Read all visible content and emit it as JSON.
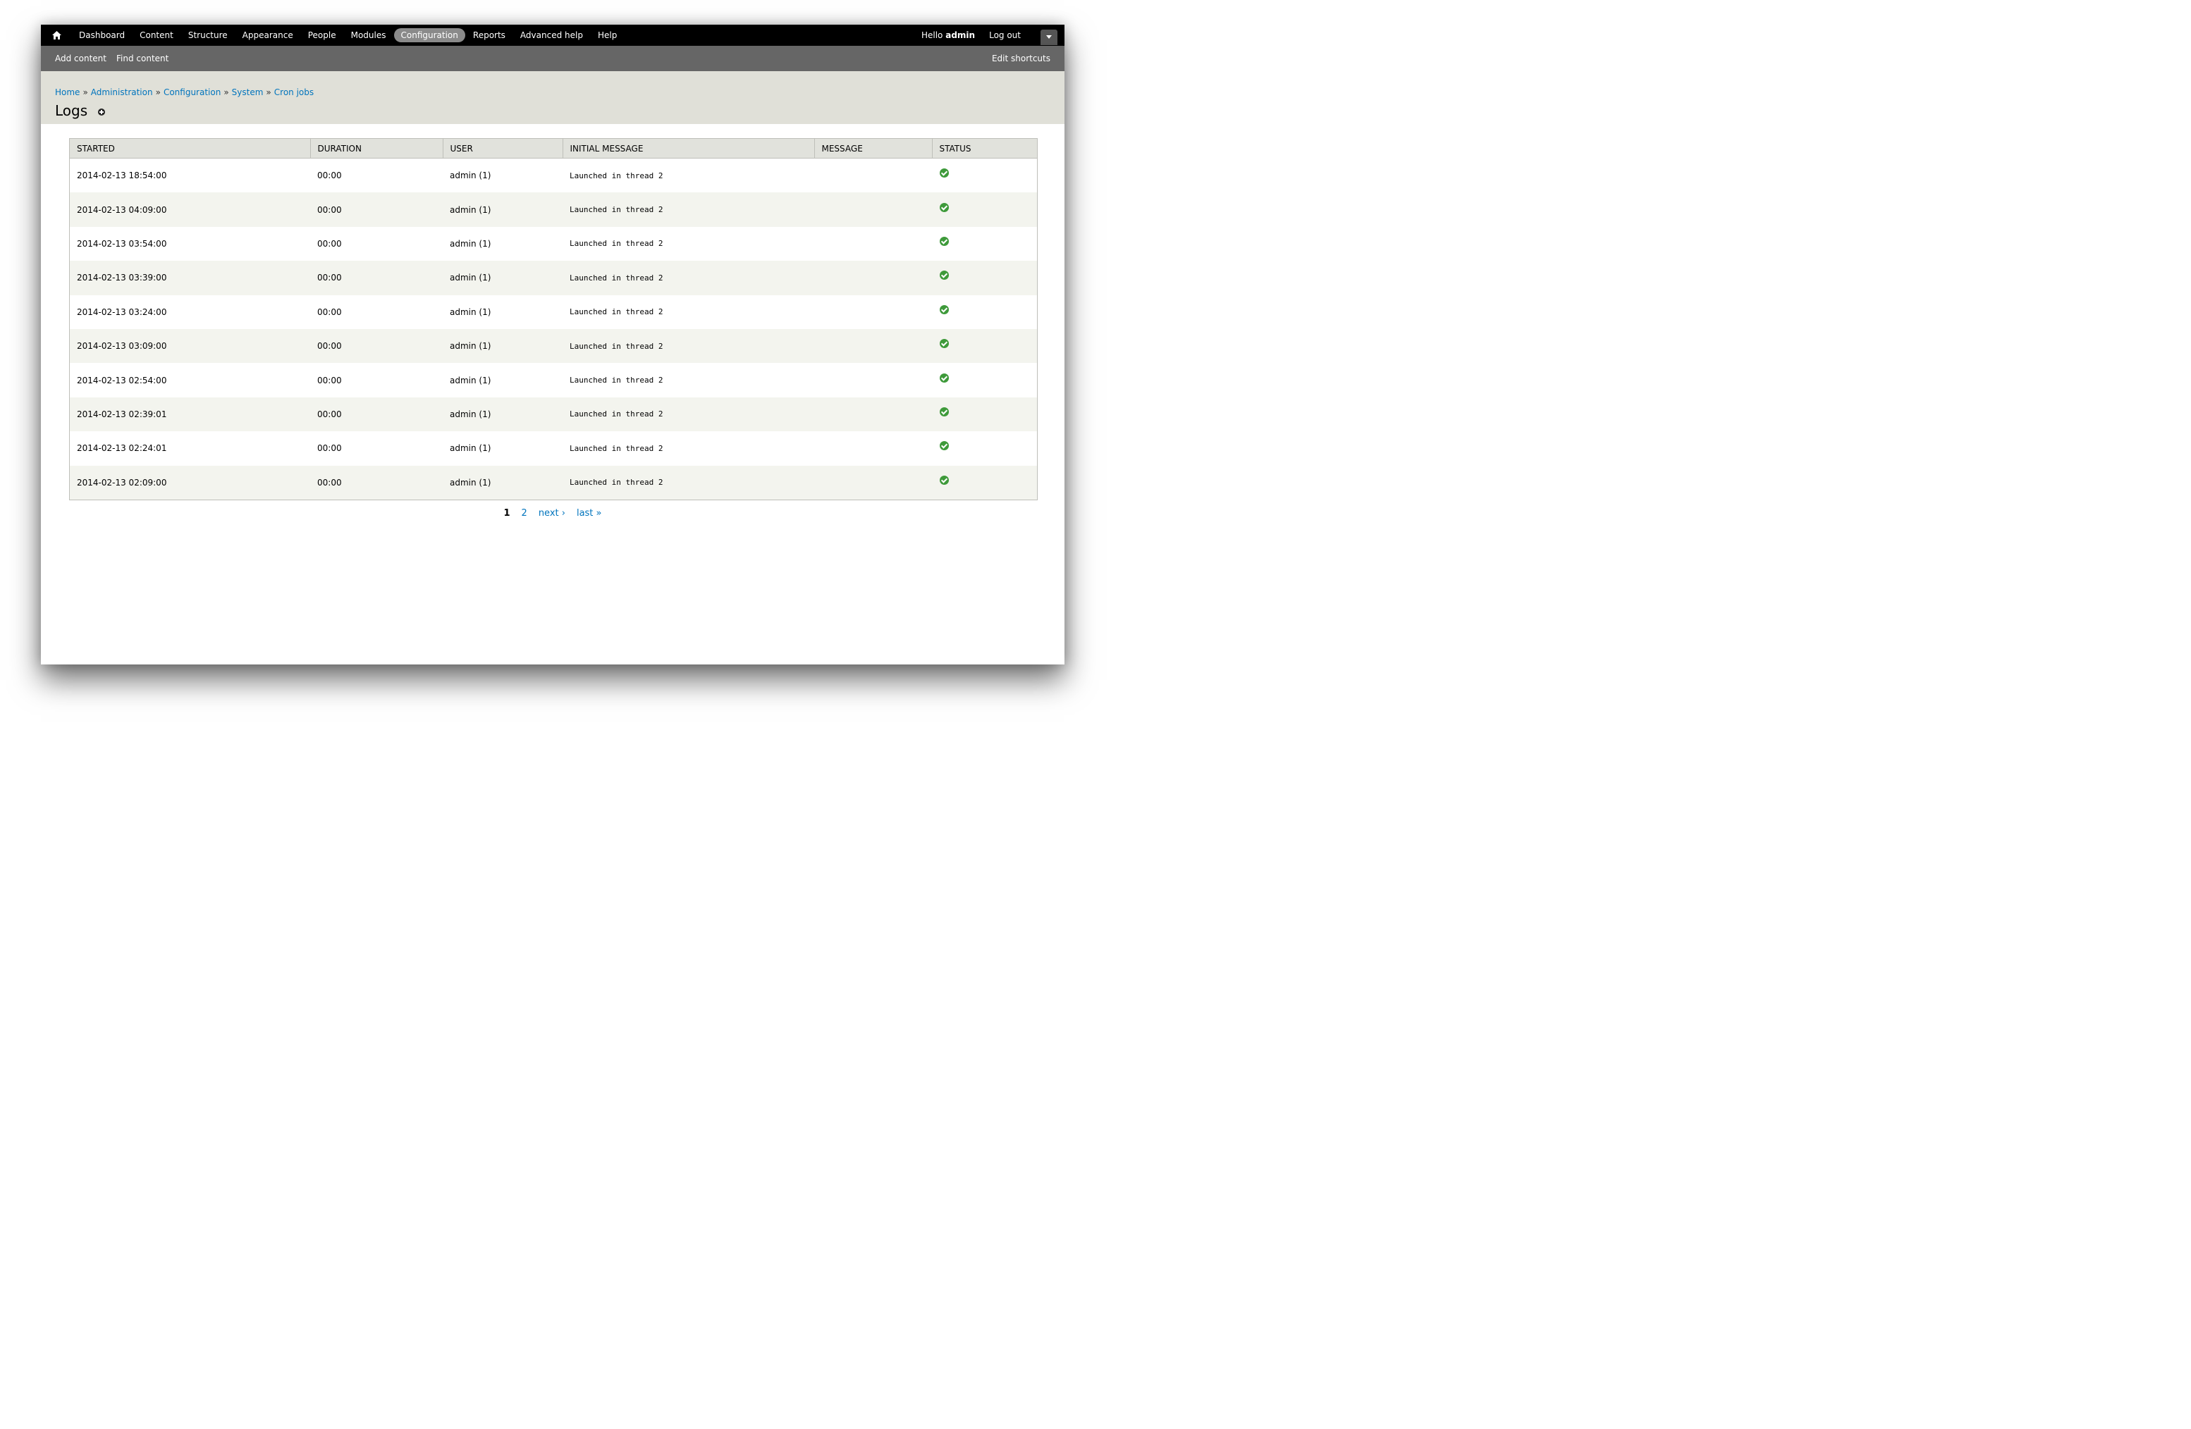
{
  "toolbar": {
    "menu": [
      {
        "label": "Dashboard",
        "active": false
      },
      {
        "label": "Content",
        "active": false
      },
      {
        "label": "Structure",
        "active": false
      },
      {
        "label": "Appearance",
        "active": false
      },
      {
        "label": "People",
        "active": false
      },
      {
        "label": "Modules",
        "active": false
      },
      {
        "label": "Configuration",
        "active": true
      },
      {
        "label": "Reports",
        "active": false
      },
      {
        "label": "Advanced help",
        "active": false
      },
      {
        "label": "Help",
        "active": false
      }
    ],
    "hello_prefix": "Hello",
    "username": "admin",
    "logout_label": "Log out"
  },
  "shortcuts": {
    "items": [
      "Add content",
      "Find content"
    ],
    "edit_label": "Edit shortcuts"
  },
  "breadcrumb": {
    "items": [
      "Home",
      "Administration",
      "Configuration",
      "System",
      "Cron jobs"
    ],
    "separator": "»"
  },
  "page": {
    "title": "Logs"
  },
  "table": {
    "headers": [
      "Started",
      "Duration",
      "User",
      "Initial message",
      "Message",
      "Status"
    ],
    "rows": [
      {
        "started": "2014-02-13 18:54:00",
        "duration": "00:00",
        "user": "admin (1)",
        "initial_message": "Launched in thread 2",
        "message": "",
        "status": "ok"
      },
      {
        "started": "2014-02-13 04:09:00",
        "duration": "00:00",
        "user": "admin (1)",
        "initial_message": "Launched in thread 2",
        "message": "",
        "status": "ok"
      },
      {
        "started": "2014-02-13 03:54:00",
        "duration": "00:00",
        "user": "admin (1)",
        "initial_message": "Launched in thread 2",
        "message": "",
        "status": "ok"
      },
      {
        "started": "2014-02-13 03:39:00",
        "duration": "00:00",
        "user": "admin (1)",
        "initial_message": "Launched in thread 2",
        "message": "",
        "status": "ok"
      },
      {
        "started": "2014-02-13 03:24:00",
        "duration": "00:00",
        "user": "admin (1)",
        "initial_message": "Launched in thread 2",
        "message": "",
        "status": "ok"
      },
      {
        "started": "2014-02-13 03:09:00",
        "duration": "00:00",
        "user": "admin (1)",
        "initial_message": "Launched in thread 2",
        "message": "",
        "status": "ok"
      },
      {
        "started": "2014-02-13 02:54:00",
        "duration": "00:00",
        "user": "admin (1)",
        "initial_message": "Launched in thread 2",
        "message": "",
        "status": "ok"
      },
      {
        "started": "2014-02-13 02:39:01",
        "duration": "00:00",
        "user": "admin (1)",
        "initial_message": "Launched in thread 2",
        "message": "",
        "status": "ok"
      },
      {
        "started": "2014-02-13 02:24:01",
        "duration": "00:00",
        "user": "admin (1)",
        "initial_message": "Launched in thread 2",
        "message": "",
        "status": "ok"
      },
      {
        "started": "2014-02-13 02:09:00",
        "duration": "00:00",
        "user": "admin (1)",
        "initial_message": "Launched in thread 2",
        "message": "",
        "status": "ok"
      }
    ]
  },
  "pager": {
    "current": "1",
    "pages": [
      "2"
    ],
    "next_label": "next ›",
    "last_label": "last »"
  },
  "colors": {
    "link": "#0074bd",
    "toolbar_bg": "#000000",
    "shortcut_bg": "#666666",
    "header_bg": "#e0e0d8",
    "status_ok": "#3e9a3a"
  },
  "icons": {
    "home": "home-icon",
    "shortcut_add": "add-shortcut-icon",
    "status_ok": "check-circle-icon",
    "drawer": "chevron-down-icon"
  }
}
